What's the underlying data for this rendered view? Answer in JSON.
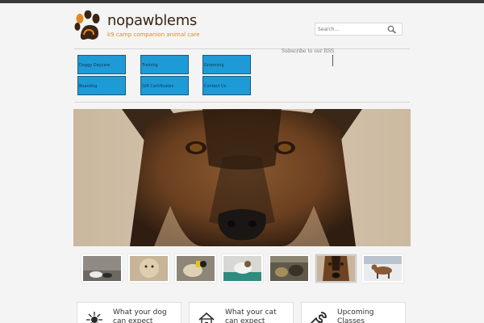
{
  "header": {
    "logo": {
      "title": "nopawblems",
      "tagline": "k9 camp companion animal care",
      "icon": "paw-print-icon"
    },
    "search": {
      "placeholder": "Search...",
      "icon": "search-icon"
    }
  },
  "nav": {
    "items": [
      {
        "label": "Doggy Daycare"
      },
      {
        "label": "Training"
      },
      {
        "label": "Grooming"
      },
      {
        "label": "Boarding"
      },
      {
        "label": "Gift Certificates"
      },
      {
        "label": "Contact Us"
      }
    ]
  },
  "rss": {
    "label": "Subscribe to our RSS"
  },
  "hero": {
    "image": "german-shepherd-closeup-photo"
  },
  "thumbnails": [
    {
      "image": "dogs-on-floor-photo"
    },
    {
      "image": "fluffy-dog-photo"
    },
    {
      "image": "dog-with-toy-photo"
    },
    {
      "image": "dog-in-bath-photo"
    },
    {
      "image": "dogs-at-daycare-photo"
    },
    {
      "image": "german-shepherd-photo",
      "active": true
    },
    {
      "image": "dog-in-snow-photo"
    }
  ],
  "cards": [
    {
      "title": "What your dog can expect",
      "icon": "paw-bug-icon"
    },
    {
      "title": "What your cat can expect",
      "icon": "house-icon"
    },
    {
      "title": "Upcoming Classes",
      "icon": "wrench-icon"
    }
  ],
  "colors": {
    "accent": "#1e9ad6",
    "brand_brown": "#3b2414",
    "brand_orange": "#e08a1e"
  }
}
